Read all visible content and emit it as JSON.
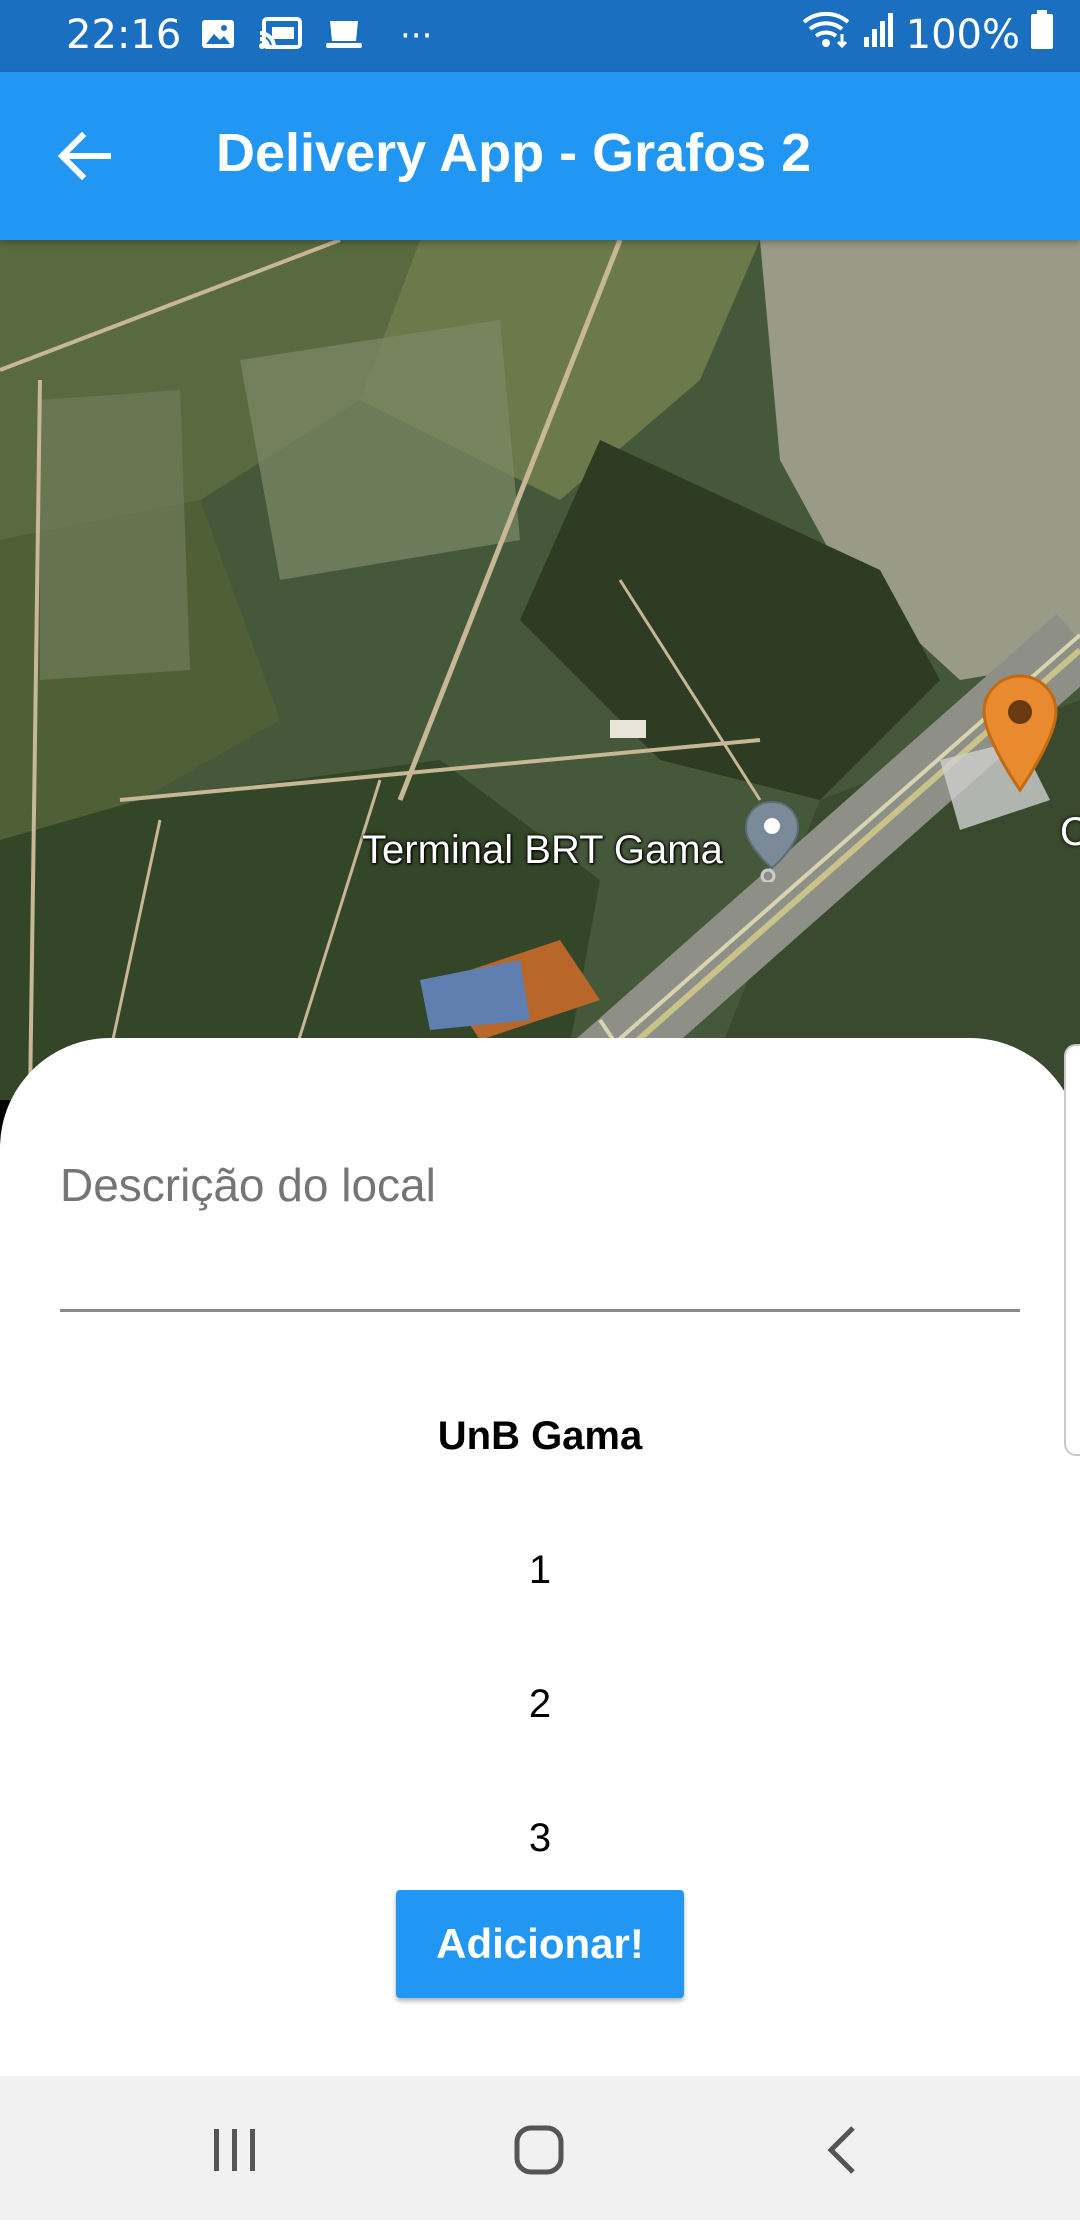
{
  "status_bar": {
    "time": "22:16",
    "battery": "100%",
    "more": "···",
    "icons_left": [
      "image-icon",
      "cast-icon",
      "app-icon"
    ],
    "icons_right": [
      "wifi-icon",
      "signal-icon",
      "battery-icon"
    ]
  },
  "app_bar": {
    "title": "Delivery App - Grafos 2",
    "back_icon": "arrow-back-icon",
    "color": "#2196f3"
  },
  "map": {
    "poi_label": "Terminal BRT Gama",
    "edge_label": "C",
    "markers": [
      "grey-place-marker",
      "orange-selected-marker"
    ],
    "marker_colors": {
      "selected": "#e88a2d",
      "poi": "#7a8a99"
    }
  },
  "sheet": {
    "description_placeholder": "Descrição do local",
    "picker_items": [
      "UnB Gama",
      "1",
      "2",
      "3"
    ],
    "selected_item": "UnB Gama",
    "add_button_label": "Adicionar!"
  },
  "nav_bar": {
    "buttons": [
      "recent-apps-icon",
      "home-icon",
      "back-icon"
    ]
  }
}
